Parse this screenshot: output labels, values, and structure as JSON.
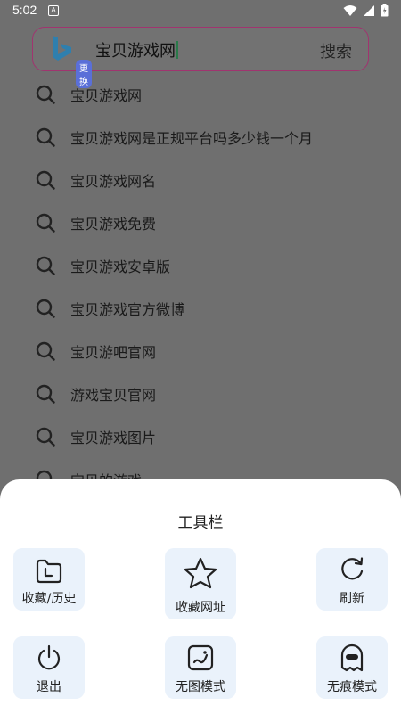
{
  "status_bar": {
    "time": "5:02",
    "app_icon": "A"
  },
  "search": {
    "query": "宝贝游戏网",
    "engine_switch_label": "更换",
    "submit_label": "搜索"
  },
  "suggestions": [
    "宝贝游戏网",
    "宝贝游戏网是正规平台吗多少钱一个月",
    "宝贝游戏网名",
    "宝贝游戏免费",
    "宝贝游戏安卓版",
    "宝贝游戏官方微博",
    "宝贝游吧官网",
    "游戏宝贝官网",
    "宝贝游戏图片",
    "宝贝的游戏"
  ],
  "toolbar": {
    "title": "工具栏",
    "items": [
      {
        "label": "收藏/历史",
        "icon": "history-folder-icon"
      },
      {
        "label": "收藏网址",
        "icon": "star-icon"
      },
      {
        "label": "刷新",
        "icon": "refresh-icon"
      },
      {
        "label": "退出",
        "icon": "power-icon"
      },
      {
        "label": "无图模式",
        "icon": "no-image-icon"
      },
      {
        "label": "无痕模式",
        "icon": "incognito-ghost-icon"
      }
    ]
  }
}
